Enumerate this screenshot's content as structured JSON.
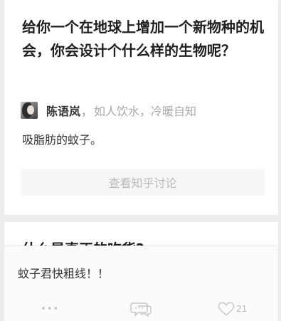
{
  "question_card": {
    "title": "给你一个在地球上增加一个新物种的机会，你会设计个什么样的生物呢？",
    "author": {
      "name": "陈语岚",
      "separator": "，",
      "bio": "如人饮水，冷暖自知"
    },
    "answer_excerpt": "吸脂肪的蚊子。",
    "discuss_button": "查看知乎讨论"
  },
  "next_card": {
    "title": "什么是真正的吃货?"
  },
  "comment_panel": {
    "text": "蚊子君快粗线！！",
    "actions": {
      "more_label": "•••",
      "like_count": "21"
    }
  },
  "colors": {
    "background": "#ededed",
    "card": "#ffffff",
    "muted_text": "#a8a8a8",
    "icon": "#c4c4c4"
  },
  "icons": [
    "more-icon",
    "comment-icon",
    "heart-icon"
  ]
}
